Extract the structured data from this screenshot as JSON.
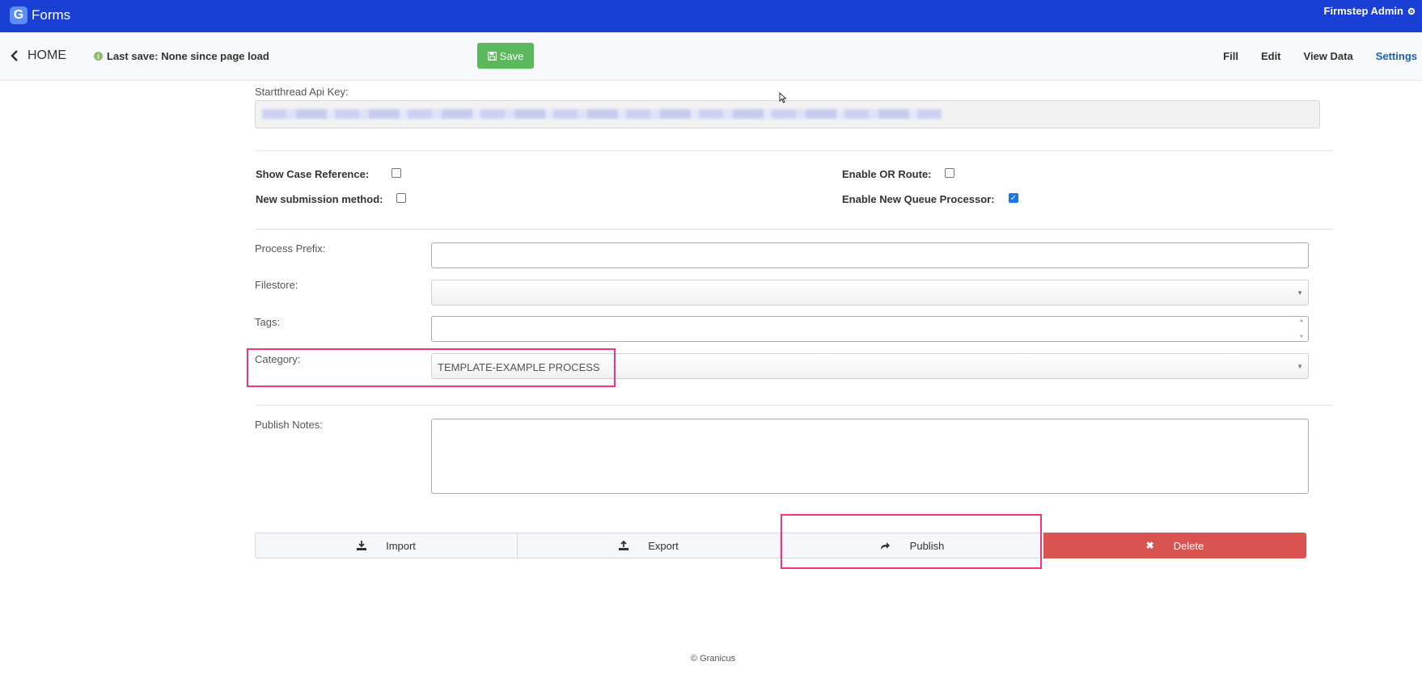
{
  "app": {
    "name": "Forms",
    "logo_letter": "G",
    "user": "Firmstep Admin"
  },
  "nav": {
    "home_label": "HOME",
    "last_save": "Last save: None since page load",
    "save_label": "Save",
    "links": [
      "Fill",
      "Edit",
      "View Data",
      "Settings"
    ],
    "active_link": "Settings"
  },
  "form": {
    "api_key_label": "Startthread Api Key:",
    "checkboxes": {
      "show_case_reference": {
        "label": "Show Case Reference:",
        "checked": false
      },
      "new_submission_method": {
        "label": "New submission method:",
        "checked": false
      },
      "enable_or_route": {
        "label": "Enable OR Route:",
        "checked": false
      },
      "enable_new_queue_processor": {
        "label": "Enable New Queue Processor:",
        "checked": true
      }
    },
    "process_prefix_label": "Process Prefix:",
    "filestore_label": "Filestore:",
    "tags_label": "Tags:",
    "category_label": "Category:",
    "category_value": "TEMPLATE-EXAMPLE PROCESS",
    "publish_notes_label": "Publish Notes:"
  },
  "actions": {
    "import_label": "Import",
    "export_label": "Export",
    "publish_label": "Publish",
    "delete_label": "Delete"
  },
  "footer": {
    "text": "© Granicus"
  },
  "colors": {
    "topbar": "#1a3fd4",
    "save": "#5cb85c",
    "delete": "#d9534f",
    "highlight": "#f0357a"
  }
}
